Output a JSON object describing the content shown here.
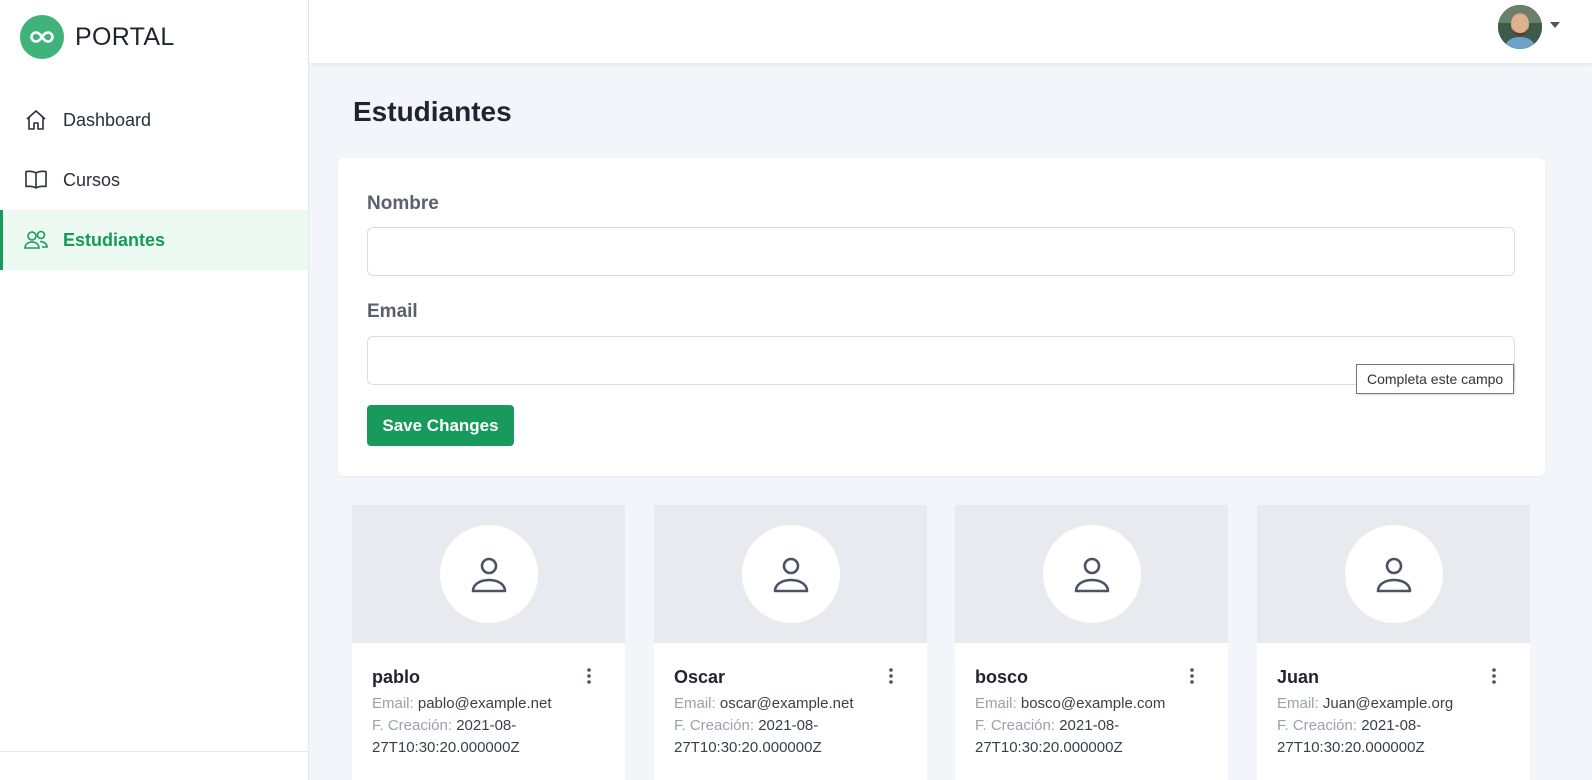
{
  "brand": {
    "name": "PORTAL",
    "accent": "#3fb37a"
  },
  "sidebar": {
    "items": [
      {
        "label": "Dashboard",
        "icon": "home-icon",
        "active": false
      },
      {
        "label": "Cursos",
        "icon": "book-icon",
        "active": false
      },
      {
        "label": "Estudiantes",
        "icon": "users-icon",
        "active": true
      }
    ]
  },
  "header": {
    "avatar": "user-avatar",
    "menu_icon": "caret-down-icon"
  },
  "page": {
    "title": "Estudiantes"
  },
  "form": {
    "name_label": "Nombre",
    "name_value": "",
    "email_label": "Email",
    "email_value": "",
    "save_label": "Save Changes",
    "validation_tooltip": "Completa este campo"
  },
  "students": [
    {
      "name": "pablo",
      "email_label": "Email:",
      "email": "pablo@example.net",
      "created_label": "F. Creación:",
      "created": "2021-08-27T10:30:20.000000Z"
    },
    {
      "name": "Oscar",
      "email_label": "Email:",
      "email": "oscar@example.net",
      "created_label": "F. Creación:",
      "created": "2021-08-27T10:30:20.000000Z"
    },
    {
      "name": "bosco",
      "email_label": "Email:",
      "email": "bosco@example.com",
      "created_label": "F. Creación:",
      "created": "2021-08-27T10:30:20.000000Z"
    },
    {
      "name": "Juan",
      "email_label": "Email:",
      "email": "Juan@example.org",
      "created_label": "F. Creación:",
      "created": "2021-08-27T10:30:20.000000Z"
    }
  ],
  "colors": {
    "primary": "#179a5b",
    "active_bg": "#ecfaf2",
    "page_bg": "#f4f5fb"
  }
}
